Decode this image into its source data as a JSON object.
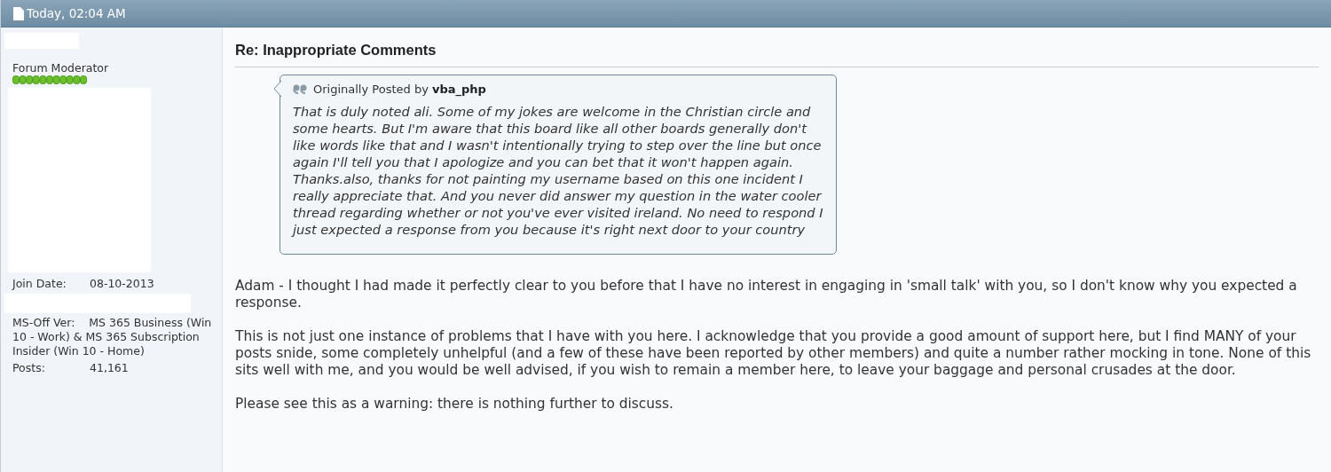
{
  "post_header": {
    "date": "Today, 02:04 AM"
  },
  "user_info": {
    "title": "Forum Moderator",
    "details": [
      {
        "label": "Join Date:",
        "value": "08-10-2013"
      },
      {
        "label": "MS-Off Ver:",
        "value": "MS 365 Business (Win 10 - Work) & MS 365 Subscription Insider (Win 10 - Home)"
      },
      {
        "label": "Posts:",
        "value": "41,161"
      }
    ]
  },
  "post": {
    "title": "Re: Inappropriate Comments",
    "quote": {
      "prefix": "Originally Posted by",
      "author": "vba_php",
      "text": "That is duly noted ali. Some of my jokes are welcome in the Christian circle and some hearts. But I'm aware that this board like all other boards generally don't like words like that and I wasn't intentionally trying to step over the line but once again I'll tell you that I apologize and you can bet that it won't happen again. Thanks.also, thanks for not painting my username based on this one incident I really appreciate that. And you never did answer my question in the water cooler thread regarding whether or not you've ever visited ireland. No need to respond I just expected a response from you because it's right next door to your country"
    },
    "paragraphs": [
      "Adam - I thought I had made it perfectly clear to you before that I have no interest in engaging in 'small talk' with you, so I don't know why you expected a response.",
      "This is not just one instance of problems that I have with you here. I acknowledge that you provide a good amount of support here, but I find MANY of your posts snide, some completely unhelpful (and a few of these have been reported by other members) and quite a number rather mocking in tone. None of this sits well with me, and you would be well advised, if you wish to remain a member here, to leave your baggage and personal crusades at the door.",
      "Please see this as a warning: there is nothing further to discuss."
    ]
  }
}
